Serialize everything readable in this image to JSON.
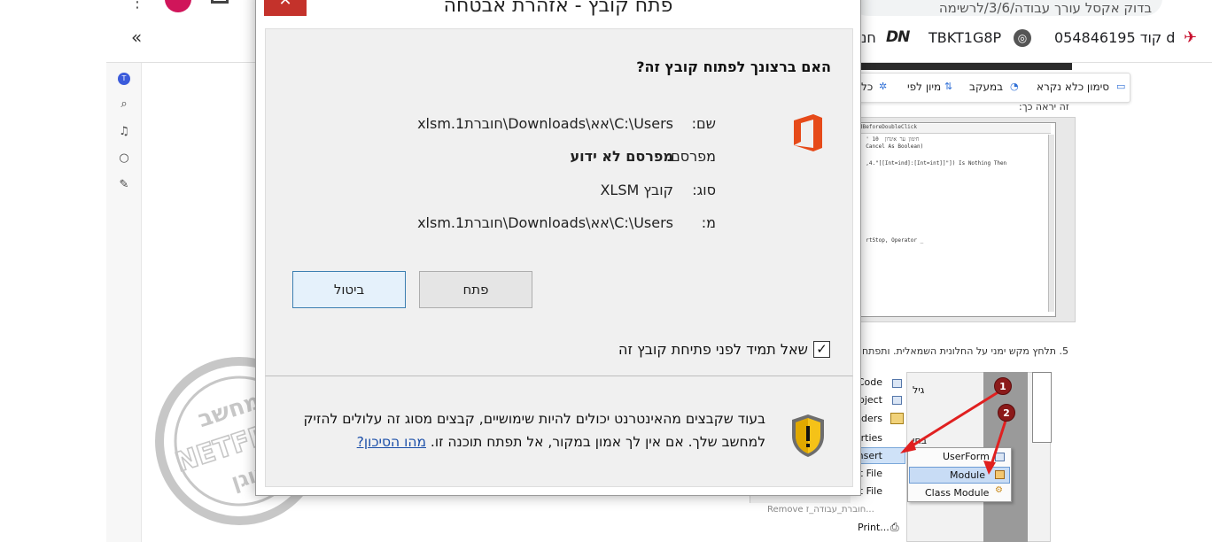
{
  "browser": {
    "address_text": "בדוק אקסל עורך עבודה/3/6/לרשימה",
    "bookmarks": {
      "item1": "קוד 054846195 d",
      "item2": "TBKT1G8P",
      "item3": "חנ"
    }
  },
  "sidebar": {
    "badge": "T"
  },
  "article": {
    "toolbar": {
      "mark_unread": "סימון כלא נקרא",
      "tracking": "במעקב",
      "sort_by": "מיון לפי",
      "all": "כל"
    },
    "line_top": "זה יראה כך:",
    "step5": "5. תלחץ מקש ימני על החלונית השמאלית. ותפתח",
    "code_title": "dBeforeDoubleClick",
    "code_lines": [
      "  ' חימון ער אינדון  10",
      "  Cancel As Boolean)",
      "  ,4.\"[[Int=ind]:[Int=int]]\"]) Is Nothing Then",
      "  rtStop, Operator _"
    ],
    "menu": {
      "code": "Code",
      "object": "Object",
      "folders": "Folders",
      "properties": "Properties",
      "insert": "Insert",
      "import": "Import File",
      "export": "Export File",
      "remove": "Remove חוברת_עבודה_ז...",
      "print": "Print...",
      "sub_userform": "UserForm",
      "sub_module": "Module",
      "sub_class": "Class Module",
      "left_label1": "גיל",
      "left_label2": "בחי",
      "badge1": "1",
      "badge2": "2"
    }
  },
  "watermark": {
    "text_top": "מחשב",
    "text_mid": "NETFREE",
    "text_bottom": "מוגן"
  },
  "dialog": {
    "title": "פתח קובץ - אזהרת אבטחה",
    "close": "✕",
    "question": "האם ברצונך לפתוח קובץ זה?",
    "fields": [
      {
        "label": "שם:",
        "value": "C:\\Users\\אא\\Downloads\\חוברת1.xlsm",
        "bold": false
      },
      {
        "label": "מפרסם:",
        "value": "מפרסם לא ידוע",
        "bold": true
      },
      {
        "label": "סוג:",
        "value": "קובץ XLSM",
        "bold": false
      },
      {
        "label": "מ:",
        "value": "C:\\Users\\אא\\Downloads\\חוברת1.xlsm",
        "bold": false
      }
    ],
    "open_button": "פתח",
    "cancel_button": "ביטול",
    "checkbox_label": "שאל תמיד לפני פתיחת קובץ זה",
    "checkbox_mark": "✓",
    "warning_text": "בעוד שקבצים מהאינטרנט יכולים להיות שימושיים, קבצים מסוג זה עלולים להזיק למחשב שלך. אם אין לך אמון במקור, אל תפתח תוכנה זו.",
    "warning_link": "מהו הסיכון?"
  }
}
